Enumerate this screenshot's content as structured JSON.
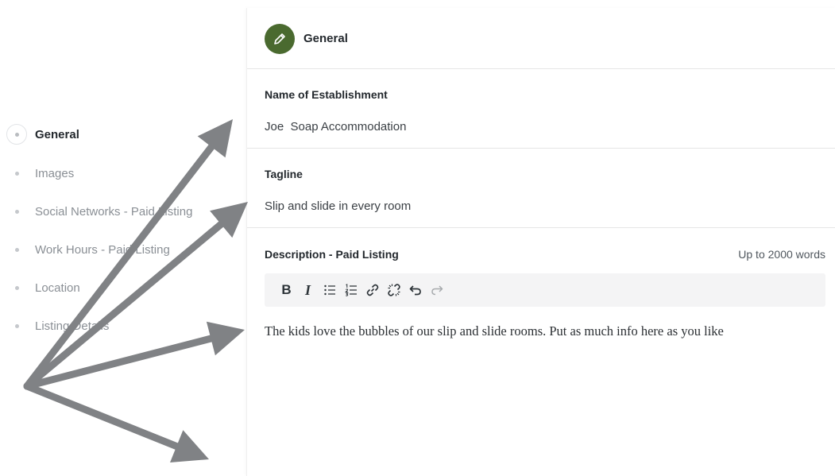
{
  "sidebar": {
    "items": [
      {
        "label": "General",
        "active": true
      },
      {
        "label": "Images",
        "active": false
      },
      {
        "label": "Social Networks - Paid Listing",
        "active": false
      },
      {
        "label": "Work Hours - Paid Listing",
        "active": false
      },
      {
        "label": "Location",
        "active": false
      },
      {
        "label": "Listing Details",
        "active": false
      }
    ]
  },
  "panel": {
    "header": {
      "title": "General",
      "icon": "pencil-icon",
      "icon_color": "#4a6a2f"
    },
    "fields": [
      {
        "label": "Name of Establishment",
        "value": "Joe  Soap Accommodation"
      },
      {
        "label": "Tagline",
        "value": "Slip and slide in every room"
      }
    ],
    "description": {
      "label": "Description - Paid Listing",
      "limit": "Up to 2000 words",
      "toolbar": {
        "bold": "B",
        "italic": "I",
        "icons": [
          "bulleted-list-icon",
          "numbered-list-icon",
          "link-icon",
          "unlink-icon",
          "undo-icon",
          "redo-icon"
        ]
      },
      "content": "The kids love the bubbles of our slip and slide rooms. Put as much info here as you like"
    }
  },
  "annotation": {
    "arrow_color": "#808285",
    "icon": "annotation-arrows"
  }
}
